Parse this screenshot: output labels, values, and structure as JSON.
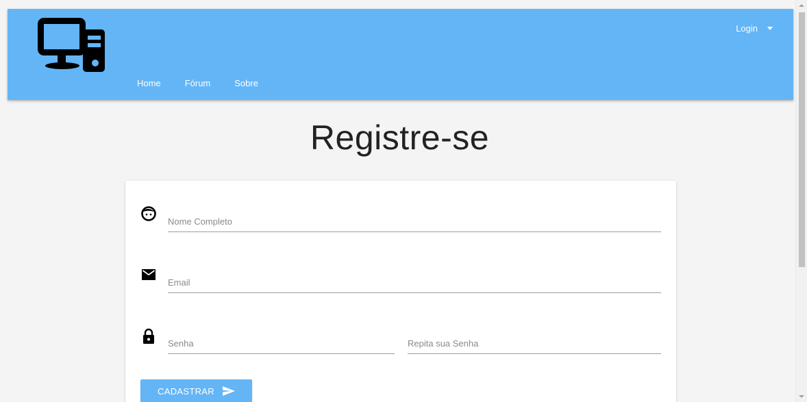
{
  "nav": {
    "links": [
      "Home",
      "Fórum",
      "Sobre"
    ],
    "login_label": "Login"
  },
  "page": {
    "title": "Registre-se"
  },
  "form": {
    "full_name_placeholder": "Nome Completo",
    "email_placeholder": "Email",
    "password_placeholder": "Senha",
    "repeat_password_placeholder": "Repita sua Senha",
    "submit_label": "CADASTRAR"
  },
  "icons": {
    "logo": "desktop-computer-icon",
    "name": "face-icon",
    "email": "mail-icon",
    "password": "lock-icon",
    "submit": "send-icon"
  },
  "colors": {
    "primary": "#64b5f6",
    "background": "#f4f4f4"
  }
}
